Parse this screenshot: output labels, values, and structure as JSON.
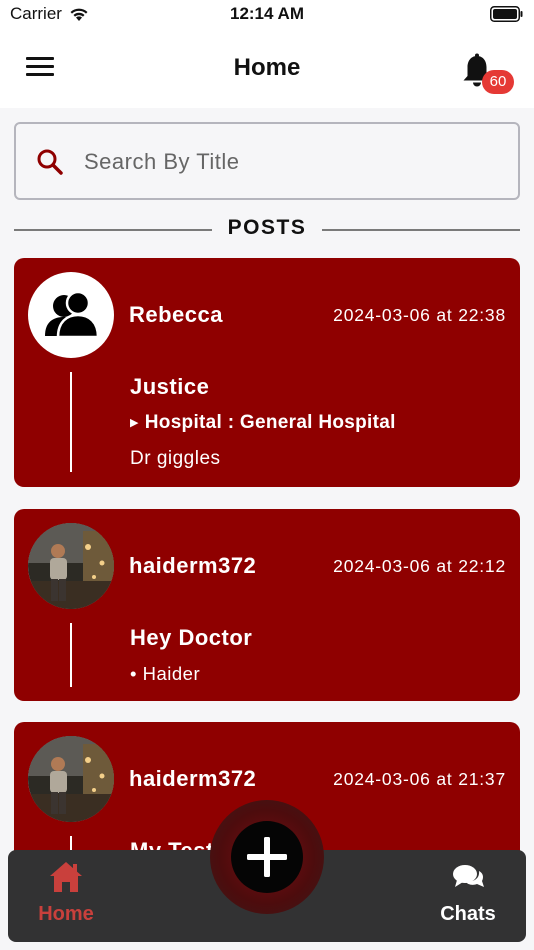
{
  "status_bar": {
    "carrier": "Carrier",
    "time": "12:14 AM"
  },
  "header": {
    "title": "Home",
    "notification_count": "60"
  },
  "search": {
    "placeholder": "Search By Title",
    "value": ""
  },
  "section": {
    "title": "POSTS"
  },
  "posts": [
    {
      "author": "Rebecca",
      "timestamp": "2024-03-06 at 22:38",
      "title": "Justice",
      "meta": "Hospital : General Hospital",
      "description": "Dr giggles",
      "avatar": "default-user-icon"
    },
    {
      "author": "haiderm372",
      "timestamp": "2024-03-06 at 22:12",
      "title": "Hey Doctor",
      "bullet": "• Haider",
      "avatar": "photo-avatar"
    },
    {
      "author": "haiderm372",
      "timestamp": "2024-03-06 at 21:37",
      "title": "My Test P",
      "avatar": "photo-avatar"
    }
  ],
  "tabs": [
    {
      "label": "Home",
      "icon": "home-icon",
      "active": true,
      "color": "#c9403c"
    },
    {
      "label": "Chats",
      "icon": "chat-bubbles-icon",
      "active": false,
      "color": "#ffffff"
    }
  ],
  "colors": {
    "accent": "#8f0000",
    "badge": "#e53935",
    "tab_bar": "#323233"
  }
}
